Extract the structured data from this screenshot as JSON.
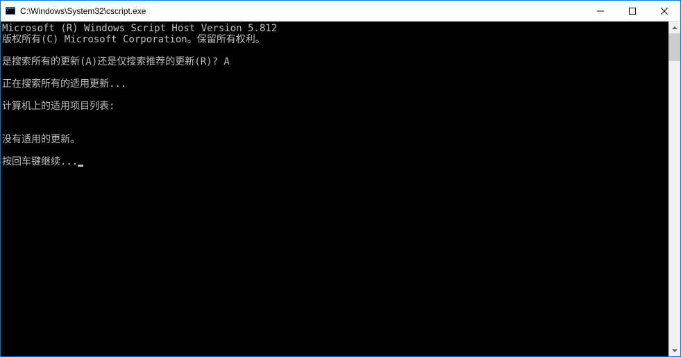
{
  "window": {
    "title": "C:\\Windows\\System32\\cscript.exe"
  },
  "console": {
    "lines": [
      "Microsoft (R) Windows Script Host Version 5.812",
      "版权所有(C) Microsoft Corporation。保留所有权利。",
      "",
      "是搜索所有的更新(A)还是仅搜索推荐的更新(R)? A",
      "",
      "正在搜索所有的适用更新...",
      "",
      "计算机上的适用项目列表:",
      "",
      "",
      "没有适用的更新。",
      "",
      "按回车键继续..."
    ]
  }
}
